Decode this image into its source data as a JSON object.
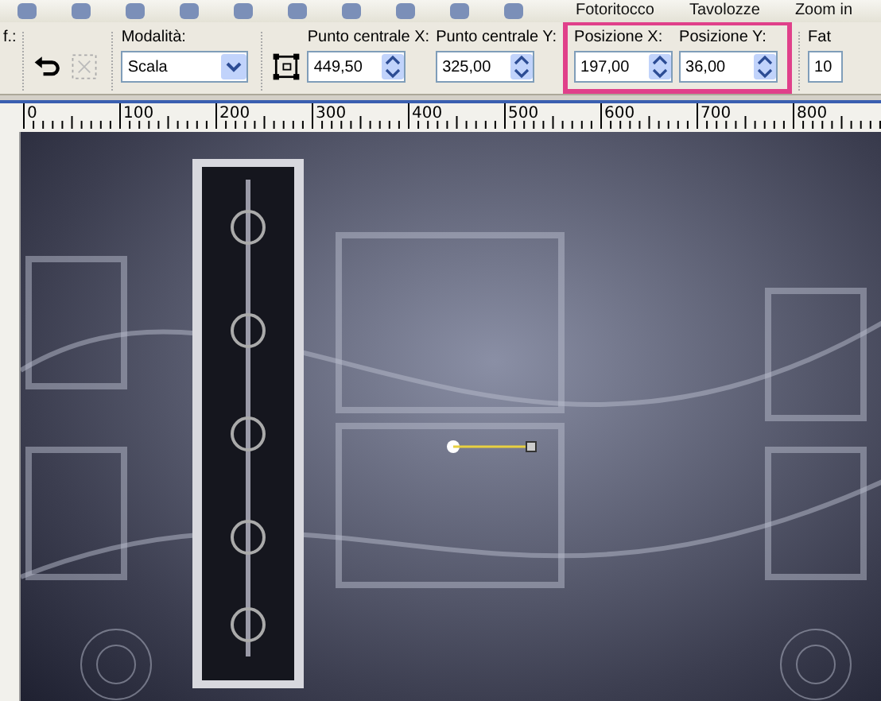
{
  "top_toolbar": {
    "items": [
      "Fotoritocco",
      "Tavolozze",
      "Zoom in"
    ]
  },
  "options_bar": {
    "left_label": "f.:",
    "mode": {
      "label": "Modalità:",
      "value": "Scala"
    },
    "spin_fields": [
      {
        "label": "Punto centrale X:",
        "value": "449,50"
      },
      {
        "label": "Punto centrale Y:",
        "value": "325,00"
      }
    ],
    "highlighted_fields": [
      {
        "label": "Posizione X:",
        "value": "197,00"
      },
      {
        "label": "Posizione Y:",
        "value": "36,00"
      }
    ],
    "right_field": {
      "label": "Fat",
      "value": "10"
    }
  },
  "ruler": {
    "labels": [
      "0",
      "100",
      "200",
      "300",
      "400",
      "500",
      "600",
      "700",
      "800"
    ]
  }
}
